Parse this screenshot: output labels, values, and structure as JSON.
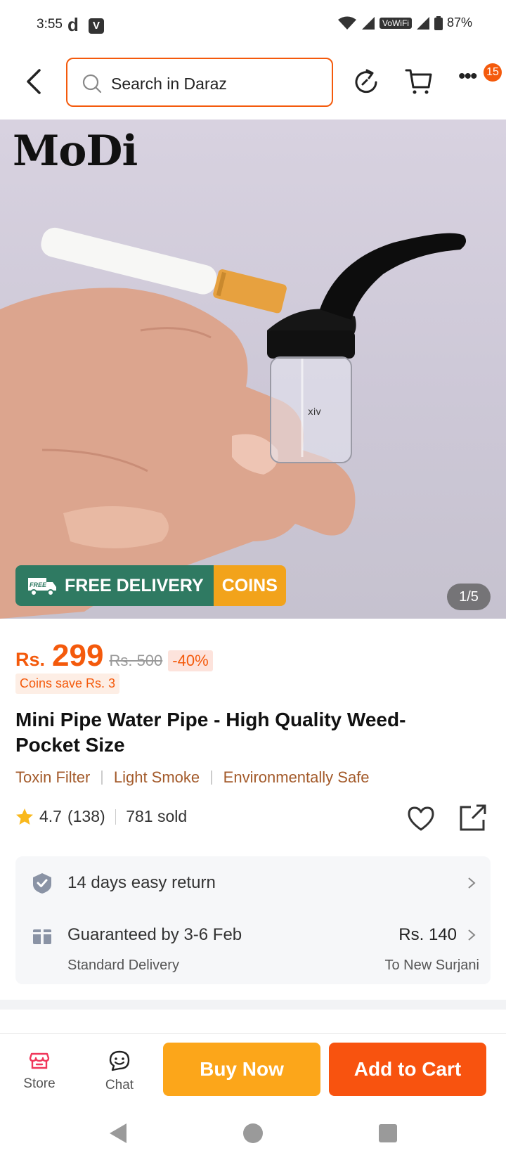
{
  "status_bar": {
    "time": "3:55",
    "app_letter_d": "d",
    "app_letter_v": "V",
    "vowifi": "VoWiFi",
    "battery": "87%"
  },
  "header": {
    "search_placeholder": "Search in Daraz",
    "cart_badge": "15"
  },
  "hero": {
    "brand_logo": "MoDi",
    "promo_free_label": "FREE",
    "promo_free": "FREE DELIVERY",
    "promo_coins": "COINS",
    "image_counter": "1/5"
  },
  "product": {
    "currency": "Rs.",
    "price": "299",
    "original_price": "Rs. 500",
    "discount": "-40%",
    "coins_save": "Coins save Rs. 3",
    "title": "Mini Pipe Water Pipe - High Quality Weed-Pocket Size",
    "tags": [
      "Toxin Filter",
      "Light Smoke",
      "Environmentally Safe"
    ],
    "rating": "4.7",
    "review_count": "(138)",
    "sold": "781 sold"
  },
  "service": {
    "return_policy": "14 days easy return",
    "delivery_guarantee": "Guaranteed by 3-6 Feb",
    "delivery_type": "Standard Delivery",
    "delivery_fee": "Rs. 140",
    "delivery_destination": "To New Surjani"
  },
  "bottom_bar": {
    "store": "Store",
    "chat": "Chat",
    "buy_now": "Buy Now",
    "add_to_cart": "Add to Cart"
  },
  "colors": {
    "accent": "#f45a0c",
    "buy_now": "#fca61a",
    "add_to_cart": "#f8530f",
    "free_delivery": "#2f7a62",
    "coins": "#f2a31b"
  }
}
